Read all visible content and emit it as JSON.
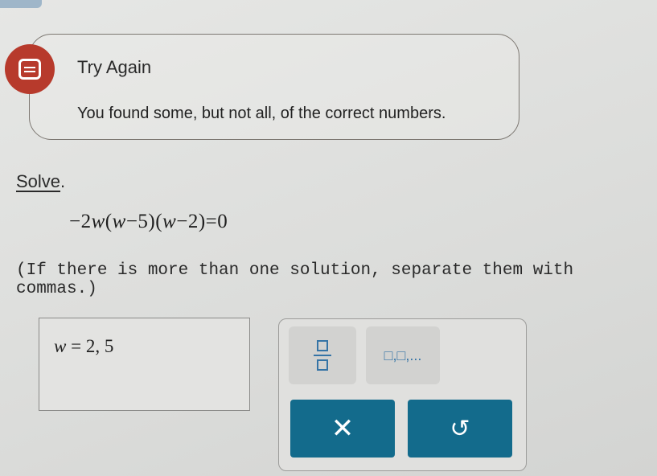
{
  "feedback": {
    "icon": "chat-bubble-icon",
    "title": "Try Again",
    "message": "You found some, but not all, of the correct numbers."
  },
  "problem": {
    "prompt_word": "Solve",
    "prompt_punct": ".",
    "equation": {
      "coef": "−2",
      "var1": "w",
      "open1": "(",
      "var2": "w",
      "rest1": "−5)(",
      "var3": "w",
      "rest2": "−2)=0"
    },
    "instructions": "(If there is more than one solution, separate them with commas.)"
  },
  "answer": {
    "variable": "w",
    "equals": " = ",
    "value": "2, 5"
  },
  "keypad": {
    "list_label": "□,□,...",
    "clear_label": "✕",
    "undo_label": "↺"
  },
  "colors": {
    "error": "#b73a2c",
    "action_button": "#136b8c",
    "keypad_icon": "#3574a6"
  }
}
